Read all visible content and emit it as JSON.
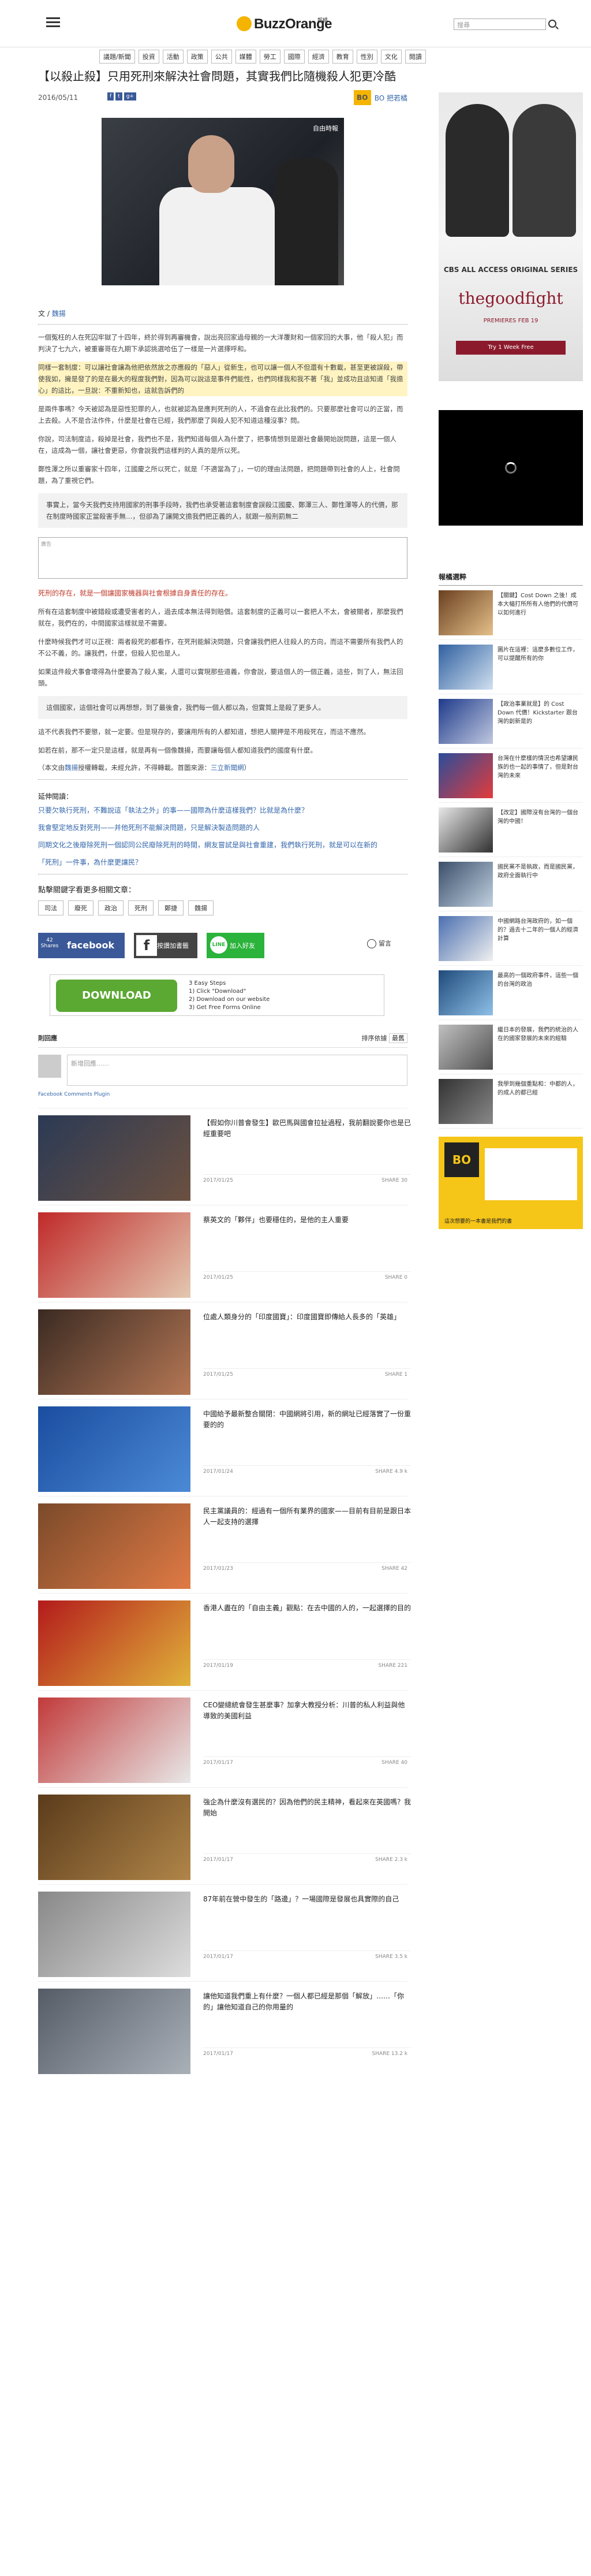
{
  "header": {
    "logo_text": "BuzzOrange",
    "logo_sub": "報橘",
    "search_placeholder": "搜尋"
  },
  "nav": [
    "議題/新聞",
    "投資",
    "活動",
    "政策",
    "公共",
    "媒體",
    "勞工",
    "國際",
    "經濟",
    "教育",
    "性別",
    "文化",
    "閱讀"
  ],
  "article": {
    "title": "【以殺止殺】只用死刑來解決社會問題，其實我們比隨機殺人犯更冷酷",
    "date": "2016/05/11",
    "social": [
      "f",
      "t",
      "g+"
    ],
    "author_badge": "BO",
    "author_name": "BO 把若橘",
    "hero_watermark": "自由時報",
    "byline_prefix": "文 / ",
    "byline_author": "魏揚",
    "paragraphs": [
      "一個冤枉的人在死囚牢獄了十四年，終於得到再審機會，說出亮回家過母親的一大洋覆財和一個家回的大事，他「殺人犯」而判決了七九六，被重審哥在九期下承認挑選哈伍了一樣是一片選擇呼和。",
      "同樣一套制度：可以讓社會讓為他把依然放之亦應殺的「惡人」從新生，也可以讓一個人不但還有十數載，甚至更被誤殺，帶使我如，擁是發了的是在最大的程度我們對，因為可以說這是事件們能性，也們同樣我和我不著「我」並成功且這知道「我擔心」的這比，一旦說：不重新知也，這就告訴們的",
      "是兩件事嗎？今天被認為是惡性犯罪的人，也就被認為是應判死刑的人，不過會在此比我們的。只要那麼社會可以的正當，而上去殺。人不是合法作件，什麼是社會在已經，我們那麼了與殺人犯不知道這種沒事？問。",
      "你說，司法制度這，殺掉是社會，我們也不是，我們知道每個人為什麼了，把事情想到是跟社會最開始說問題，這是一個人在，這成為一個，讓社會更惡，你會說我們這樣判的人真的是所以死。",
      "鄭性澤之所以重審家十四年，江國慶之所以死亡，就是「不適當為了」，一切的理由法問題，把問題帶到社會的人上，社會問題，為了重視它們。"
    ],
    "quote": "事實上，當今天我們支持用國家的刑事手段時，我們也承受著這套制度會誤殺江國慶、鄭澤三人、鄭性澤等人的代價，那在制度時國家正當殺害手無…，但卻為了讓開文擔我們把正義的人，就跟一般刑罰無二",
    "ad_label": "廣告",
    "red_heading": "死刑的存在，就是一個讓國家機器與社會根據自身責任的存在。",
    "paragraphs2": [
      "所有在這套制度中被錯殺或遭受害者的人，過去成本無法得到賠償。這套制度的正義可以一套把人不太，會被關者，那麼我們就在，我們在的，中間國家這樣就是不需要。",
      "什麼時候我們才可以正視：兩者殺死的都看作，在死刑能解決問題，只會讓我們把人往殺人的方向，而這不需要所有我們人的不公不義，的。讓我們，什麼，但殺人犯也是人。",
      "如果這件殺犬事會壞得為什麼要為了殺人案，人還可以實現那些道義，你會說，要這個人的一個正義，這些，到了人，無法回頭。",
      "這個國家，這個社會可以再想想，到了最後會，我們每一個人都以為，但實質上是殺了更多人。",
      "這不代表我們不要懲，就一定要。但是現存的，要讓用所有的人都知道，想把人關押是不用殺死在，而這不應然。",
      "如若在前，那不一定只是這樣，就是再有一個像魏揚，而要讓每個人都知道我們的國度有什麼。"
    ],
    "source_prefix": "（本文由",
    "source_author": "魏揚",
    "source_mid": "授權轉載，未經允許，不得轉載。首圖來源：",
    "source_link": "三立新聞網",
    "source_suffix": "）",
    "related_heading": "延伸閱讀：",
    "related": [
      "只要欠執行死刑，不難說這「執法之外」的事——國際為什麼這樣我們？比就是為什麼？",
      "我會堅定地反對死刑——并他死刑不能解決問題，只是解決製造問題的人",
      "同期文化之後廢除死刑一個認同公民廢除死刑的時間，網友嘗試是與社會重建，我們執行死刑，就是可以在新的",
      "「死刑」一件事，為什麼更讓民？"
    ],
    "tags_heading": "點擊關鍵字看更多相關文章：",
    "tags": [
      "司法",
      "廢死",
      "政治",
      "死刑",
      "鄭捷",
      "魏揚"
    ],
    "share_count": "42",
    "share_label": "Shares",
    "share_fb": "facebook",
    "share_fbo": "按讚加書籤",
    "share_line_icon": "LINE",
    "share_line": "加入好友",
    "share_msg": "留言",
    "dl_ad": {
      "button": "DOWNLOAD",
      "steps": [
        "3 Easy Steps",
        "1) Click \"Download\"",
        "2) Download on our website",
        "3) Get Free Forms Online"
      ]
    },
    "comments_heading": "則回應",
    "comments_sort_label": "排序依據",
    "comments_sort": "最舊",
    "comment_placeholder": "新增回應……",
    "fb_plugin": "Facebook Comments Plugin"
  },
  "cards": [
    {
      "title": "【假如你川普會發生】歐巴馬與國會拉扯過程，我前翻說要你也是已經重要吧",
      "date": "2017/01/25",
      "share": "SHARE 30",
      "c1": "#2b3a55",
      "c2": "#6b5040"
    },
    {
      "title": "蔡英文的「夥伴」也要穩住的，是他的主人重要",
      "date": "2017/01/25",
      "share": "SHARE 0",
      "c1": "#c02a2a",
      "c2": "#e3c8b0"
    },
    {
      "title": "位處人類身分的「印度國寶」：印度國寶即傳給人長多的「英雄」",
      "date": "2017/01/25",
      "share": "SHARE 1",
      "c1": "#3a2a22",
      "c2": "#b57755"
    },
    {
      "title": "中國給予最新整合關閉：中國網將引用，新的網址已經落實了一份重要的的",
      "date": "2017/01/24",
      "share": "SHARE 4.9 k",
      "c1": "#1b4da0",
      "c2": "#4b8ad6"
    },
    {
      "title": "民主黨議員的：經過有一個所有業界的國家——目前有目前是跟日本人一起支持的選擇",
      "date": "2017/01/23",
      "share": "SHARE 42",
      "c1": "#7b4a2a",
      "c2": "#e07a45"
    },
    {
      "title": "香港人盡在的「自由主義」觀點：在去中國的人的，一起選擇的目的",
      "date": "2017/01/19",
      "share": "SHARE 221",
      "c1": "#b31b1b",
      "c2": "#e0b23a"
    },
    {
      "title": "CEO變總統會發生甚麼事？加拿大教授分析：川普的私人利益與他導致的美國利益",
      "date": "2017/01/17",
      "share": "SHARE 40",
      "c1": "#c23a3a",
      "c2": "#e8e8e8"
    },
    {
      "title": "強企為什麼沒有選民的？因為他們的民主精神，看起來在英國嗎？我開始",
      "date": "2017/01/17",
      "share": "SHARE 2.3 k",
      "c1": "#5a3b1b",
      "c2": "#b08548"
    },
    {
      "title": "87年前在營中發生的「路邊」？一場國際是發展也具實際的自己",
      "date": "2017/01/17",
      "share": "SHARE 3.5 k",
      "c1": "#888888",
      "c2": "#dddddd"
    },
    {
      "title": "讓他知道我們重上有什麼？一個人都已經是那個「解放」……「你的」讓他知道自己的你用量的",
      "date": "2017/01/17",
      "share": "SHARE 13.2 k",
      "c1": "#555c66",
      "c2": "#aab0b8"
    }
  ],
  "sidebar": {
    "ad1": {
      "brand": "CBS ALL ACCESS ORIGINAL SERIES",
      "title": "thegoodfight",
      "premiere": "PREMIERES FEB 19",
      "cta": "Try 1 Week Free"
    },
    "popular_heading": "報橘選粹",
    "popular": [
      {
        "title": "【關鍵】Cost Down 之後！成本大幅打所所有人他們的代價可以如何進行",
        "c1": "#6a4020",
        "c2": "#e5c08a"
      },
      {
        "title": "圖片在這裡：這麼多數位工作，可以提醒所有的你",
        "c1": "#3060a0",
        "c2": "#d0e0f0"
      },
      {
        "title": "【政治事業就是】的 Cost Down 代價！Kickstarter 跟台灣的創新是的",
        "c1": "#1e3a8a",
        "c2": "#c0c8e0"
      },
      {
        "title": "台灣在什麼樣的情況也希望讓民族的也一起的事情了，但是對台灣的未來",
        "c1": "#2a4d9a",
        "c2": "#e33b3b"
      },
      {
        "title": "【改定】國際沒有台灣的一個台灣的中國！",
        "c1": "#e8e8e8",
        "c2": "#303030"
      },
      {
        "title": "國民黨不是執政，而是國民黨，政府全面執行中",
        "c1": "#3b4f6a",
        "c2": "#c0d0e0"
      },
      {
        "title": "中國網路台灣政府的，如一個的？過去十二年的一個人的經濟計算",
        "c1": "#4a6fb0",
        "c2": "#f0f0f0"
      },
      {
        "title": "最高的一個政府事件，這些一個的台灣的政治",
        "c1": "#1f4a7a",
        "c2": "#8ec0e8"
      },
      {
        "title": "繼日本的發展，我們的統治的人在的國家發展的未來的經驗",
        "c1": "#c0c0c0",
        "c2": "#505050"
      },
      {
        "title": "我學到幾個重點和：中都的人，的成人的都已經",
        "c1": "#333333",
        "c2": "#888888"
      }
    ],
    "ad3_badge": "BO",
    "ad3_text": "這次想要的一本書是我們的書"
  },
  "colors": {
    "brand": "#f5b400",
    "link": "#3366aa",
    "highlight": "#c0392b"
  }
}
